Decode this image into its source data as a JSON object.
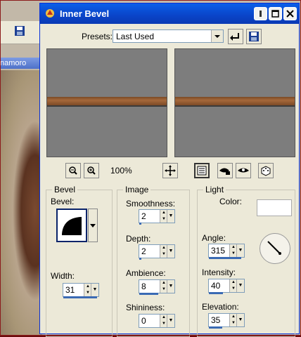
{
  "background_app": {
    "title_fragment": "namoro"
  },
  "dialog": {
    "title": "Inner Bevel",
    "presets_label": "Presets:",
    "presets_value": "Last Used",
    "zoom_level": "100%",
    "bevel_group": {
      "title": "Bevel",
      "bevel_label": "Bevel:",
      "width_label": "Width:",
      "width_value": "31"
    },
    "image_group": {
      "title": "Image",
      "smoothness_label": "Smoothness:",
      "smoothness_value": "2",
      "depth_label": "Depth:",
      "depth_value": "2",
      "ambience_label": "Ambience:",
      "ambience_value": "8",
      "shininess_label": "Shininess:",
      "shininess_value": "0"
    },
    "light_group": {
      "title": "Light",
      "color_label": "Color:",
      "color_value": "#ffffff",
      "angle_label": "Angle:",
      "angle_value": "315",
      "intensity_label": "Intensity:",
      "intensity_value": "40",
      "elevation_label": "Elevation:",
      "elevation_value": "35"
    }
  },
  "colors": {
    "title_bar": "#0a4fd8",
    "dialog_bg": "#ece9d8",
    "bevel_band": "#a5683a",
    "preview_bg": "#7d7d7d"
  }
}
